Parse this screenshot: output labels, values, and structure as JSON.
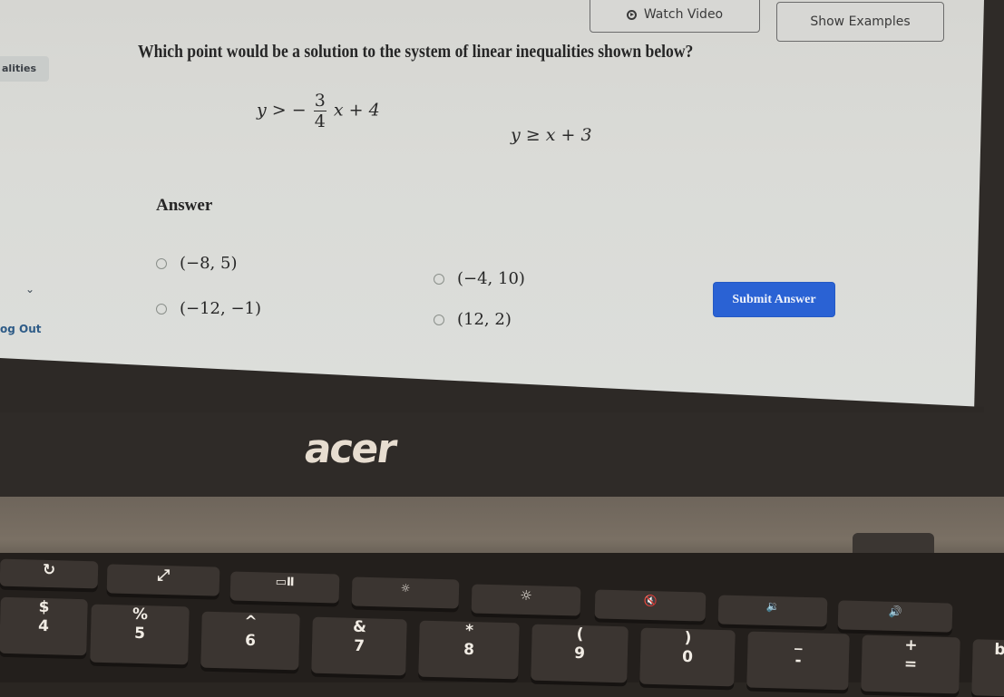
{
  "sidebar": {
    "active_item": "alities",
    "logout_label": "og Out",
    "chevron": "⌄"
  },
  "toolbar": {
    "watch_video_label": "Watch Video",
    "show_examples_label": "Show Examples"
  },
  "question": {
    "text": "Which point would be a solution to the system of linear inequalities shown below?",
    "inequality1": {
      "lhs": "y",
      "op": ">",
      "sign": "−",
      "numerator": "3",
      "denominator": "4",
      "rest": "x + 4"
    },
    "inequality2": {
      "lhs": "y",
      "op": "≥",
      "rhs": "x + 3"
    }
  },
  "answer": {
    "label": "Answer",
    "options": [
      "(−8, 5)",
      "(−4, 10)",
      "(−12, −1)",
      "(12, 2)"
    ],
    "submit_label": "Submit Answer"
  },
  "device": {
    "brand": "acer"
  },
  "keyboard": {
    "function_row": [
      "↻",
      "⤢",
      "▭Ⅱ",
      "☼",
      "☼",
      "🔇",
      "🔉",
      "🔊"
    ],
    "number_row": [
      {
        "sym": "$",
        "main": "4"
      },
      {
        "sym": "%",
        "main": "5"
      },
      {
        "sym": "^",
        "main": "6"
      },
      {
        "sym": "&",
        "main": "7"
      },
      {
        "sym": "*",
        "main": "8"
      },
      {
        "sym": "(",
        "main": "9"
      },
      {
        "sym": ")",
        "main": "0"
      },
      {
        "sym": "_",
        "main": "-"
      },
      {
        "sym": "+",
        "main": "="
      },
      {
        "sym": "",
        "main": "b"
      }
    ]
  }
}
